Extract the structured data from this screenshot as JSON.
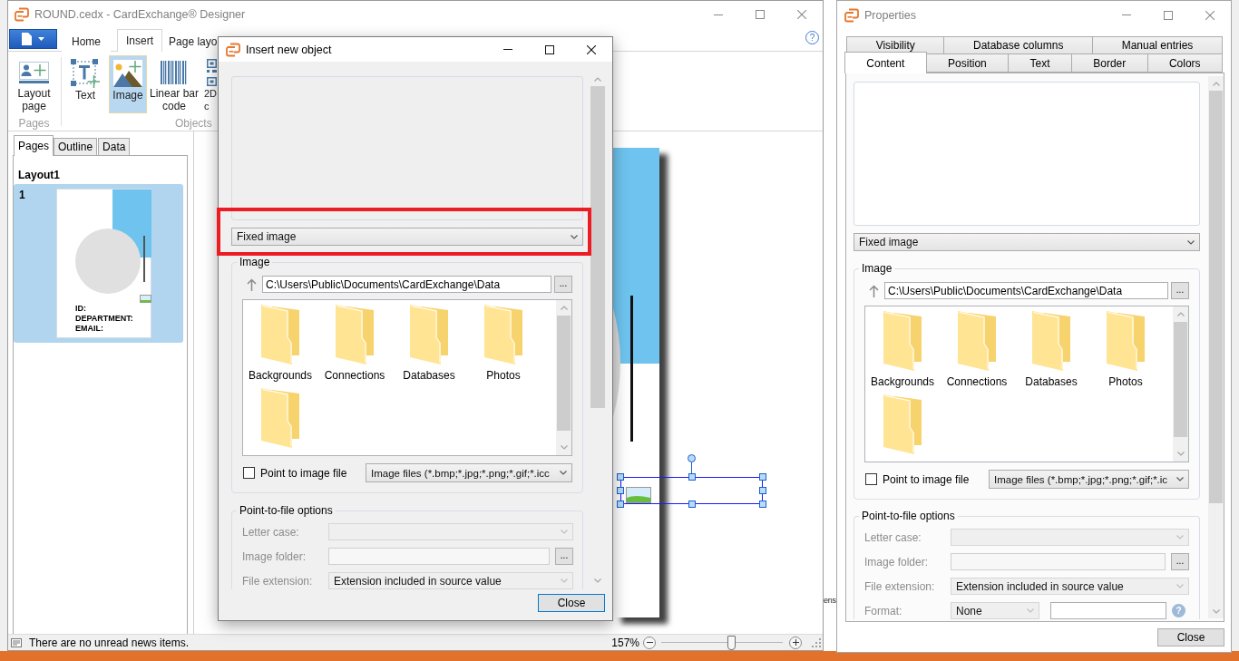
{
  "main_window": {
    "title": "ROUND.cedx - CardExchange® Designer",
    "active": false,
    "ribbon_tabs": [
      {
        "label": "Home",
        "selected": false
      },
      {
        "label": "Insert",
        "selected": true
      },
      {
        "label": "Page layo",
        "selected": false
      }
    ],
    "help": "?",
    "ribbon_groups": [
      {
        "label": "Pages",
        "buttons": [
          {
            "kind": "layout",
            "label": "Layout page",
            "selected": false
          }
        ]
      },
      {
        "label": "Objects",
        "buttons": [
          {
            "kind": "text",
            "label": "Text",
            "selected": false
          },
          {
            "kind": "image",
            "label": "Image",
            "selected": true
          },
          {
            "kind": "barcode",
            "label": "Linear bar code",
            "selected": false
          },
          {
            "kind": "qrcode",
            "label": "2D c",
            "selected": false
          }
        ]
      }
    ],
    "side_tabs": [
      {
        "label": "Pages",
        "selected": true
      },
      {
        "label": "Outline",
        "selected": false
      },
      {
        "label": "Data",
        "selected": false
      }
    ],
    "layout_name": "Layout1",
    "pages": [
      {
        "number": "1",
        "selected": true,
        "thumbnail_labels": [
          "ID:",
          "DEPARTMENT:",
          "EMAIL:"
        ]
      }
    ],
    "status_bar": {
      "news": "There are no unread news items.",
      "zoom": "157%",
      "zoom_slider": {
        "level": 0.58
      }
    }
  },
  "insert_dialog": {
    "title": "Insert new object",
    "active": true,
    "source": {
      "value": "Fixed image",
      "highlighted": true
    },
    "image_group": {
      "legend": "Image",
      "path": "C:\\Users\\Public\\Documents\\CardExchange\\Data",
      "browse": "...",
      "folders": [
        {
          "kind": "folder",
          "name": "Backgrounds"
        },
        {
          "kind": "folder",
          "name": "Connections"
        },
        {
          "kind": "folder",
          "name": "Databases"
        },
        {
          "kind": "folder",
          "name": "Photos"
        },
        {
          "kind": "partial"
        }
      ]
    },
    "point_to_file": {
      "label": "Point to image file",
      "checked": false
    },
    "file_filter": "Image files (*.bmp;*.jpg;*.png;*.gif;*.icc",
    "options_group": {
      "legend": "Point-to-file options",
      "rows": [
        {
          "kind": "combo",
          "label": "Letter case:",
          "disabled": true
        },
        {
          "kind": "browse",
          "label": "Image folder:",
          "button": "...",
          "disabled": true
        },
        {
          "kind": "combo",
          "label": "File extension:",
          "value": "Extension included in source value",
          "disabled": true
        }
      ]
    },
    "close_button": {
      "label": "Close",
      "default": true
    }
  },
  "properties": {
    "title": "Properties",
    "active": false,
    "tab_rows": [
      [
        {
          "label": "Visibility",
          "selected": false
        },
        {
          "label": "Database columns",
          "selected": false
        },
        {
          "label": "Manual entries",
          "selected": false
        }
      ],
      [
        {
          "label": "Content",
          "selected": true
        },
        {
          "label": "Position",
          "selected": false
        },
        {
          "label": "Text",
          "selected": false
        },
        {
          "label": "Border",
          "selected": false
        },
        {
          "label": "Colors",
          "selected": false
        }
      ]
    ],
    "source": {
      "value": "Fixed image",
      "highlighted": false
    },
    "image_group": {
      "legend": "Image",
      "path": "C:\\Users\\Public\\Documents\\CardExchange\\Data",
      "browse": "...",
      "folders": [
        {
          "kind": "folder",
          "name": "Backgrounds"
        },
        {
          "kind": "folder",
          "name": "Connections"
        },
        {
          "kind": "folder",
          "name": "Databases"
        },
        {
          "kind": "folder",
          "name": "Photos"
        },
        {
          "kind": "partial"
        }
      ]
    },
    "point_to_file": {
      "label": "Point to image file",
      "checked": false
    },
    "file_filter": "Image files (*.bmp;*.jpg;*.png;*.gif;*.ic",
    "options_group": {
      "legend": "Point-to-file options",
      "rows": [
        {
          "kind": "combo",
          "label": "Letter case:",
          "disabled": true
        },
        {
          "kind": "browse",
          "label": "Image folder:",
          "button": "...",
          "disabled": true
        },
        {
          "kind": "combo",
          "label": "File extension:",
          "value": "Extension included in source value",
          "disabled": true
        },
        {
          "kind": "format",
          "label": "Format:",
          "value": "None",
          "help": "?",
          "disabled": true
        }
      ]
    },
    "close_button": {
      "label": "Close",
      "default": false
    }
  },
  "background_window": {
    "text": "ens"
  }
}
